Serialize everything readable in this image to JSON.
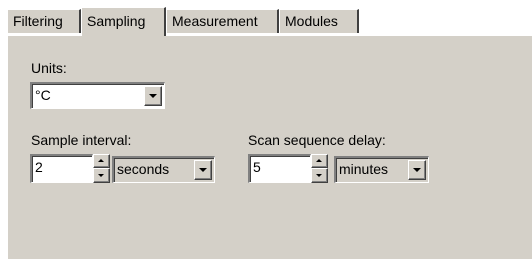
{
  "tabs": [
    {
      "label": "Filtering",
      "active": false
    },
    {
      "label": "Sampling",
      "active": true
    },
    {
      "label": "Measurement",
      "active": false
    },
    {
      "label": "Modules",
      "active": false
    }
  ],
  "units": {
    "label": "Units:",
    "value": "°C",
    "icon": "chevron-down-icon"
  },
  "sample_interval": {
    "label": "Sample interval:",
    "value": "2",
    "unit_value": "seconds"
  },
  "scan_sequence_delay": {
    "label": "Scan sequence delay:",
    "value": "5",
    "unit_value": "minutes"
  },
  "colors": {
    "face": "#d4d0c8",
    "highlight": "#ffffff",
    "shadow": "#808080",
    "dark_shadow": "#404040"
  }
}
